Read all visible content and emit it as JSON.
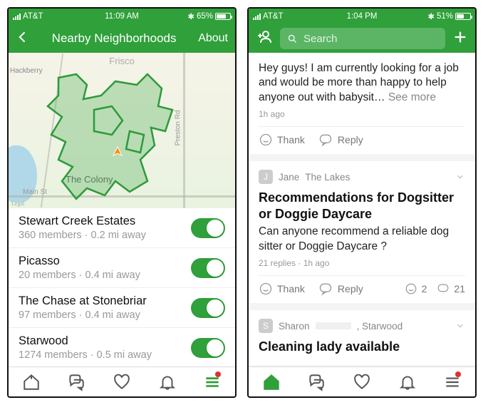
{
  "left": {
    "status": {
      "carrier": "AT&T",
      "time": "11:09 AM",
      "battery_pct": "65%",
      "battery_fill": 65
    },
    "header": {
      "title": "Nearby Neighborhoods",
      "about": "About"
    },
    "map": {
      "city": "Frisco",
      "legal": "Legal",
      "road1": "Preston Rd",
      "road2": "Main St",
      "place1": "Hackberry",
      "place2": "The Colony"
    },
    "neighborhoods": [
      {
        "name": "Stewart Creek Estates",
        "meta": "360 members · 0.2 mi away"
      },
      {
        "name": "Picasso",
        "meta": "20 members · 0.4 mi away"
      },
      {
        "name": "The Chase at Stonebriar",
        "meta": "97 members · 0.4 mi away"
      },
      {
        "name": "Starwood",
        "meta": "1274 members · 0.5 mi away"
      }
    ]
  },
  "right": {
    "status": {
      "carrier": "AT&T",
      "time": "1:04 PM",
      "battery_pct": "51%",
      "battery_fill": 51
    },
    "search_placeholder": "Search",
    "post1": {
      "text": "Hey guys! I am currently looking for a job and would be more than happy to help anyone out with babysit… ",
      "see_more": "See more",
      "time": "1h ago",
      "thank": "Thank",
      "reply": "Reply"
    },
    "post2": {
      "avatar_letter": "J",
      "author": "Jane",
      "area": "The Lakes",
      "title": "Recommendations for Dogsitter or Doggie Daycare",
      "body": "Can anyone recommend a reliable dog sitter or Doggie Daycare ?",
      "meta": "21 replies · 1h ago",
      "thank": "Thank",
      "reply": "Reply",
      "likes": "2",
      "comments": "21"
    },
    "post3": {
      "avatar_letter": "S",
      "author": "Sharon",
      "area": ", Starwood",
      "title": "Cleaning lady available"
    }
  }
}
